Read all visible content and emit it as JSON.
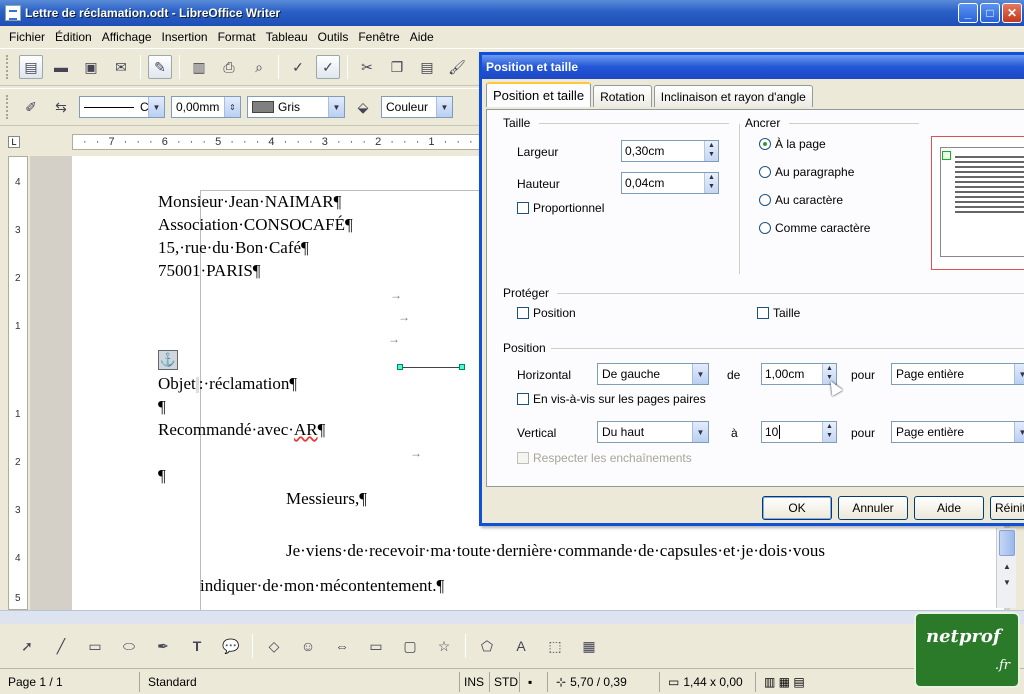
{
  "window": {
    "title": "Lettre de réclamation.odt - LibreOffice Writer"
  },
  "menu": [
    "Fichier",
    "Édition",
    "Affichage",
    "Insertion",
    "Format",
    "Tableau",
    "Outils",
    "Fenêtre",
    "Aide"
  ],
  "toolbar2": {
    "line_style": "C",
    "line_width": "0,00mm",
    "line_color": "Gris",
    "area_style": "Couleur"
  },
  "ruler": {
    "top": "· · 7 · · · 6 · · · 5 · · · 4 · · · 3 · · · 2 · · · 1 · · ·",
    "vertical": [
      "4",
      "3",
      "2",
      "1",
      "1",
      "2",
      "3",
      "4",
      "5"
    ]
  },
  "document": {
    "lines": [
      "Monsieur·Jean·NAIMAR¶",
      "Association·CONSOCAFÉ¶",
      "15,·rue·du·Bon·Café¶",
      "75001·PARIS¶"
    ],
    "objet": "Objet",
    "objet_rest": ":·réclamation¶",
    "pilcrow1": "¶",
    "recommande": "Recommandé·avec·",
    "recommande_ar": "AR",
    "recommande_end": "¶",
    "pilcrow2": "¶",
    "messieurs": "Messieurs,¶",
    "para1": "Je·viens·de·recevoir·ma·toute·dernière·commande·de·capsules·et·je·dois·vous",
    "para2": "indiquer·de·mon·mécontentement.¶",
    "tab_arrow": "→"
  },
  "dialog": {
    "title": "Position et taille",
    "tabs": [
      "Position et taille",
      "Rotation",
      "Inclinaison et rayon d'angle"
    ],
    "taille": {
      "label": "Taille",
      "largeur_label": "Largeur",
      "largeur_value": "0,30cm",
      "hauteur_label": "Hauteur",
      "hauteur_value": "0,04cm",
      "proportionnel": "Proportionnel"
    },
    "ancrer": {
      "label": "Ancrer",
      "options": [
        "À la page",
        "Au paragraphe",
        "Au caractère",
        "Comme caractère"
      ],
      "selected": "À la page"
    },
    "proteger": {
      "label": "Protéger",
      "position": "Position",
      "taille": "Taille"
    },
    "position": {
      "label": "Position",
      "horizontal_label": "Horizontal",
      "horizontal_value": "De gauche",
      "de_label": "de",
      "de_value": "1,00cm",
      "pour1_label": "pour",
      "pour1_value": "Page entière",
      "mirror": "En vis-à-vis sur les pages paires",
      "vertical_label": "Vertical",
      "vertical_value": "Du haut",
      "a_label": "à",
      "a_value": "10",
      "pour2_label": "pour",
      "pour2_value": "Page entière",
      "respect": "Respecter les enchaînements"
    },
    "buttons": {
      "ok": "OK",
      "cancel": "Annuler",
      "help": "Aide",
      "reset": "Réinit"
    }
  },
  "statusbar": {
    "page": "Page 1 / 1",
    "style": "Standard",
    "ins": "INS",
    "std": "STD",
    "position": "5,70 / 0,39",
    "size": "1,44 x 0,00"
  },
  "badge": {
    "line1": "netprof",
    "line2": ".fr"
  },
  "colors": {
    "titlebar": "#2a5fc6",
    "dialog_border": "#0f50d6",
    "badge": "#2b7a2a"
  }
}
